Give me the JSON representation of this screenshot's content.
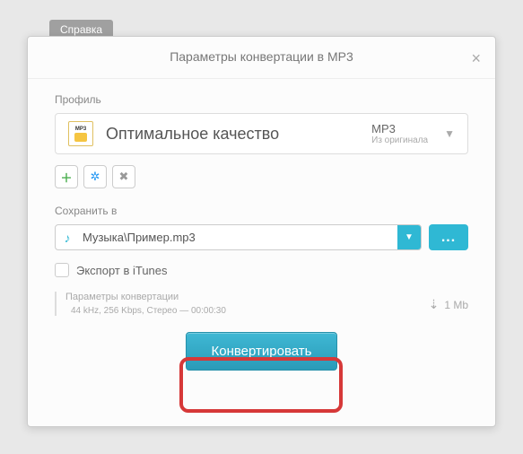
{
  "bg_tab": "Справка",
  "dialog": {
    "title": "Параметры конвертации в MP3",
    "profile_label": "Профиль",
    "profile_icon_text": "MP3",
    "profile_name": "Оптимальное качество",
    "profile_format": "MP3",
    "profile_sub": "Из оригинала",
    "save_label": "Сохранить в",
    "save_path": "Музыка\\Пример.mp3",
    "browse_dots": "...",
    "export_label": "Экспорт в iTunes",
    "params_title": "Параметры конвертации",
    "params_detail": "44 kHz, 256 Kbps, Стерео — 00:00:30",
    "size": "1 Mb",
    "convert": "Конвертировать"
  }
}
